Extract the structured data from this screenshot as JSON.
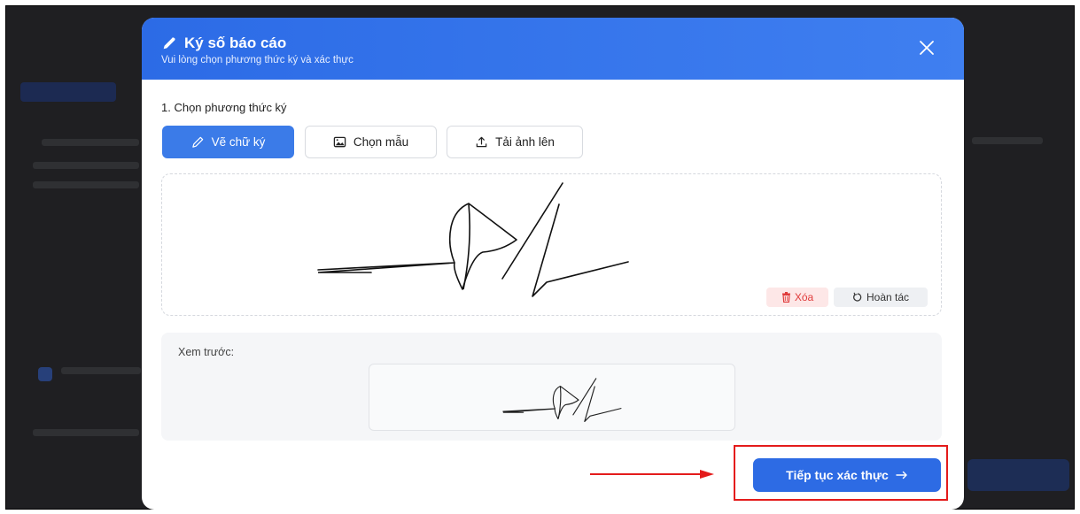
{
  "modal": {
    "title": "Ký số báo cáo",
    "subtitle": "Vui lòng chọn phương thức ký và xác thực",
    "close_icon": "close-icon"
  },
  "section": {
    "label": "1. Chọn phương thức ký"
  },
  "methods": [
    {
      "label": "Vẽ chữ ký",
      "icon": "pencil-icon",
      "active": true
    },
    {
      "label": "Chọn mẫu",
      "icon": "image-icon",
      "active": false
    },
    {
      "label": "Tải ảnh lên",
      "icon": "upload-icon",
      "active": false
    }
  ],
  "draw_actions": {
    "delete_label": "Xóa",
    "delete_icon": "trash-icon",
    "undo_label": "Hoàn tác",
    "undo_icon": "undo-icon"
  },
  "preview": {
    "label": "Xem trước:"
  },
  "footer": {
    "continue_label": "Tiếp tục xác thực",
    "continue_icon": "arrow-right-icon"
  },
  "colors": {
    "header": "#2c6be6",
    "primary_button": "#2d6be4",
    "active_method": "#3b7be8",
    "delete": "#e03b3b",
    "highlight": "#e41b1b"
  }
}
